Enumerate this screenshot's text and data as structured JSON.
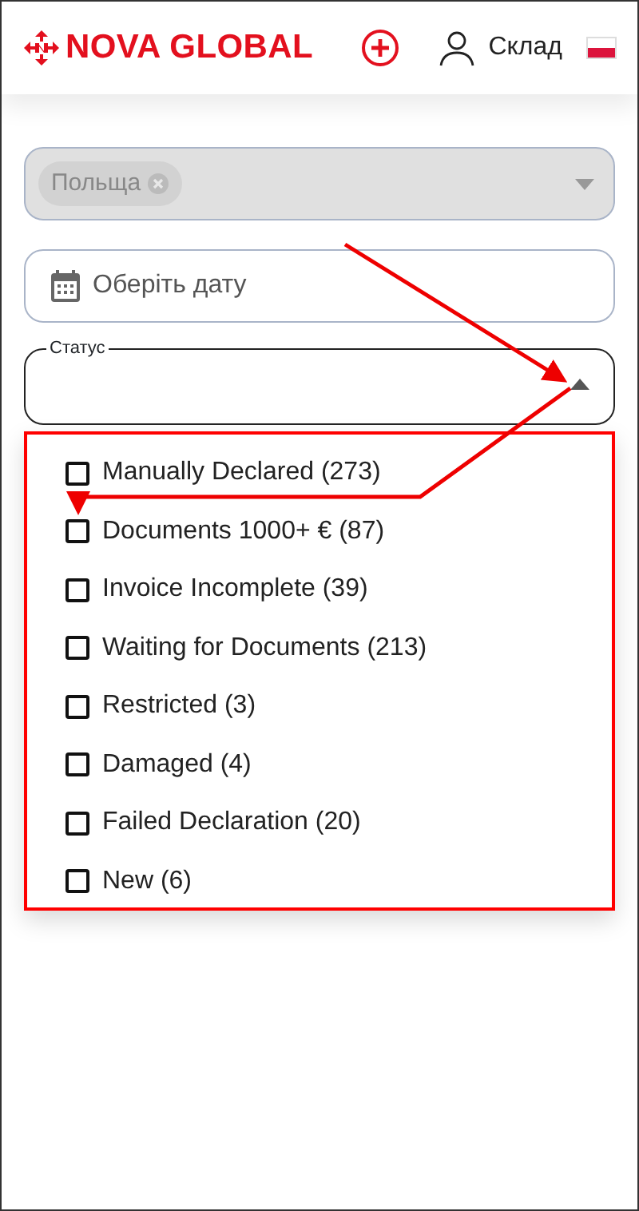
{
  "header": {
    "logo": "NOVA GLOBAL",
    "user_label": "Склад"
  },
  "country_select": {
    "disabled": true,
    "chips": [
      {
        "label": "Польща"
      }
    ]
  },
  "date_field": {
    "placeholder": "Оберіть дату"
  },
  "status_select": {
    "label": "Статус",
    "expanded": true,
    "options": [
      {
        "label": "Manually Declared (273)",
        "checked": false
      },
      {
        "label": "Documents 1000+ € (87)",
        "checked": false
      },
      {
        "label": "Invoice Incomplete (39)",
        "checked": false
      },
      {
        "label": "Waiting for Documents (213)",
        "checked": false
      },
      {
        "label": "Restricted (3)",
        "checked": false
      },
      {
        "label": "Damaged (4)",
        "checked": false
      },
      {
        "label": "Failed Declaration (20)",
        "checked": false
      },
      {
        "label": "New (6)",
        "checked": false
      }
    ]
  }
}
